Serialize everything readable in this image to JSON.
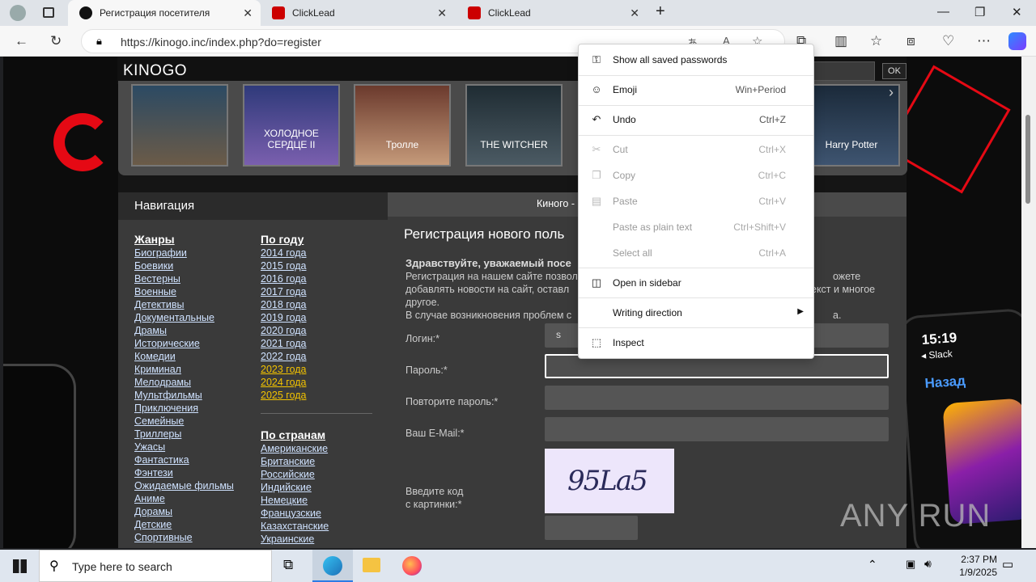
{
  "browser": {
    "tabs": [
      {
        "title": "Регистрация посетителя",
        "active": true
      },
      {
        "title": "ClickLead",
        "active": false
      },
      {
        "title": "ClickLead",
        "active": false
      }
    ],
    "url": "https://kinogo.inc/index.php?do=register"
  },
  "site": {
    "logo": "KINOGO",
    "search_button": "OK",
    "posters": [
      "",
      "ХОЛОДНОЕ СЕРДЦЕ II",
      "Тролле",
      "THE WITCHER",
      "",
      "Harry Potter"
    ],
    "nav": {
      "title": "Навигация",
      "genres_title": "Жанры",
      "genres": [
        "Биографии",
        "Боевики",
        "Вестерны",
        "Военные",
        "Детективы",
        "Документальные",
        "Драмы",
        "Исторические",
        "Комедии",
        "Криминал",
        "Мелодрамы",
        "Мультфильмы",
        "Приключения",
        "Семейные",
        "Триллеры",
        "Ужасы",
        "Фантастика",
        "Фэнтези",
        "Ожидаемые фильмы",
        "Аниме",
        "Дорамы",
        "Детские",
        "Спортивные"
      ],
      "years_title": "По году",
      "years": [
        "2014 года",
        "2015 года",
        "2016 года",
        "2017 года",
        "2018 года",
        "2019 года",
        "2020 года",
        "2021 года",
        "2022 года",
        "2023 года",
        "2024 года",
        "2025 года"
      ],
      "countries_title": "По странам",
      "countries": [
        "Американские",
        "Британские",
        "Российские",
        "Индийские",
        "Немецкие",
        "Французские",
        "Казахстанские",
        "Украинские"
      ]
    },
    "main": {
      "tab_title": "Киного -",
      "heading": "Регистрация нового поль",
      "greeting_bold": "Здравствуйте, уважаемый посе",
      "text1": "Регистрация на нашем сайте позвол",
      "text1b": "ожете",
      "text2": "добавлять новости на сайт, оставл",
      "text2b": "екст и многое",
      "text3": "другое.",
      "text4": "В случае возникновения проблем с",
      "text4b": "а.",
      "login_label": "Логин:*",
      "login_value": "s",
      "password_label": "Пароль:*",
      "password2_label": "Повторите пароль:*",
      "email_label": "Ваш E-Mail:*",
      "captcha_label1": "Введите код",
      "captcha_label2": "с картинки:*",
      "captcha_text": "95Lа5"
    }
  },
  "context_menu": {
    "items": [
      {
        "label": "Show all saved passwords",
        "shortcut": "",
        "disabled": false,
        "icon": "key-icon"
      },
      {
        "label": "Emoji",
        "shortcut": "Win+Period",
        "disabled": false,
        "icon": "emoji-icon"
      },
      {
        "label": "Undo",
        "shortcut": "Ctrl+Z",
        "disabled": false,
        "icon": "undo-icon"
      },
      {
        "label": "Cut",
        "shortcut": "Ctrl+X",
        "disabled": true,
        "icon": "scissors-icon"
      },
      {
        "label": "Copy",
        "shortcut": "Ctrl+C",
        "disabled": true,
        "icon": "copy-icon"
      },
      {
        "label": "Paste",
        "shortcut": "Ctrl+V",
        "disabled": true,
        "icon": "paste-icon"
      },
      {
        "label": "Paste as plain text",
        "shortcut": "Ctrl+Shift+V",
        "disabled": true,
        "icon": ""
      },
      {
        "label": "Select all",
        "shortcut": "Ctrl+A",
        "disabled": true,
        "icon": ""
      },
      {
        "label": "Open in sidebar",
        "shortcut": "",
        "disabled": false,
        "icon": "sidebar-icon"
      },
      {
        "label": "Writing direction",
        "shortcut": "",
        "disabled": false,
        "icon": ""
      },
      {
        "label": "Inspect",
        "shortcut": "",
        "disabled": false,
        "icon": "inspect-icon"
      }
    ]
  },
  "promo": {
    "time": "15:19",
    "app": "◂ Slack",
    "back": "Назад",
    "brand": "ANY RUN"
  },
  "taskbar": {
    "search_placeholder": "Type here to search",
    "time": "2:37 PM",
    "date": "1/9/2025"
  }
}
